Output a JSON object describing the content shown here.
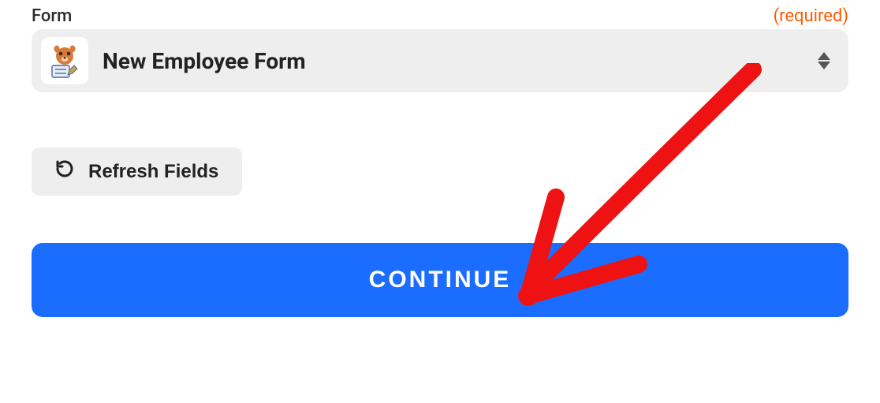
{
  "field": {
    "label": "Form",
    "required_text": "(required)",
    "selected_value": "New Employee Form"
  },
  "refresh_button": {
    "label": "Refresh Fields"
  },
  "continue_button": {
    "label": "CONTINUE"
  }
}
